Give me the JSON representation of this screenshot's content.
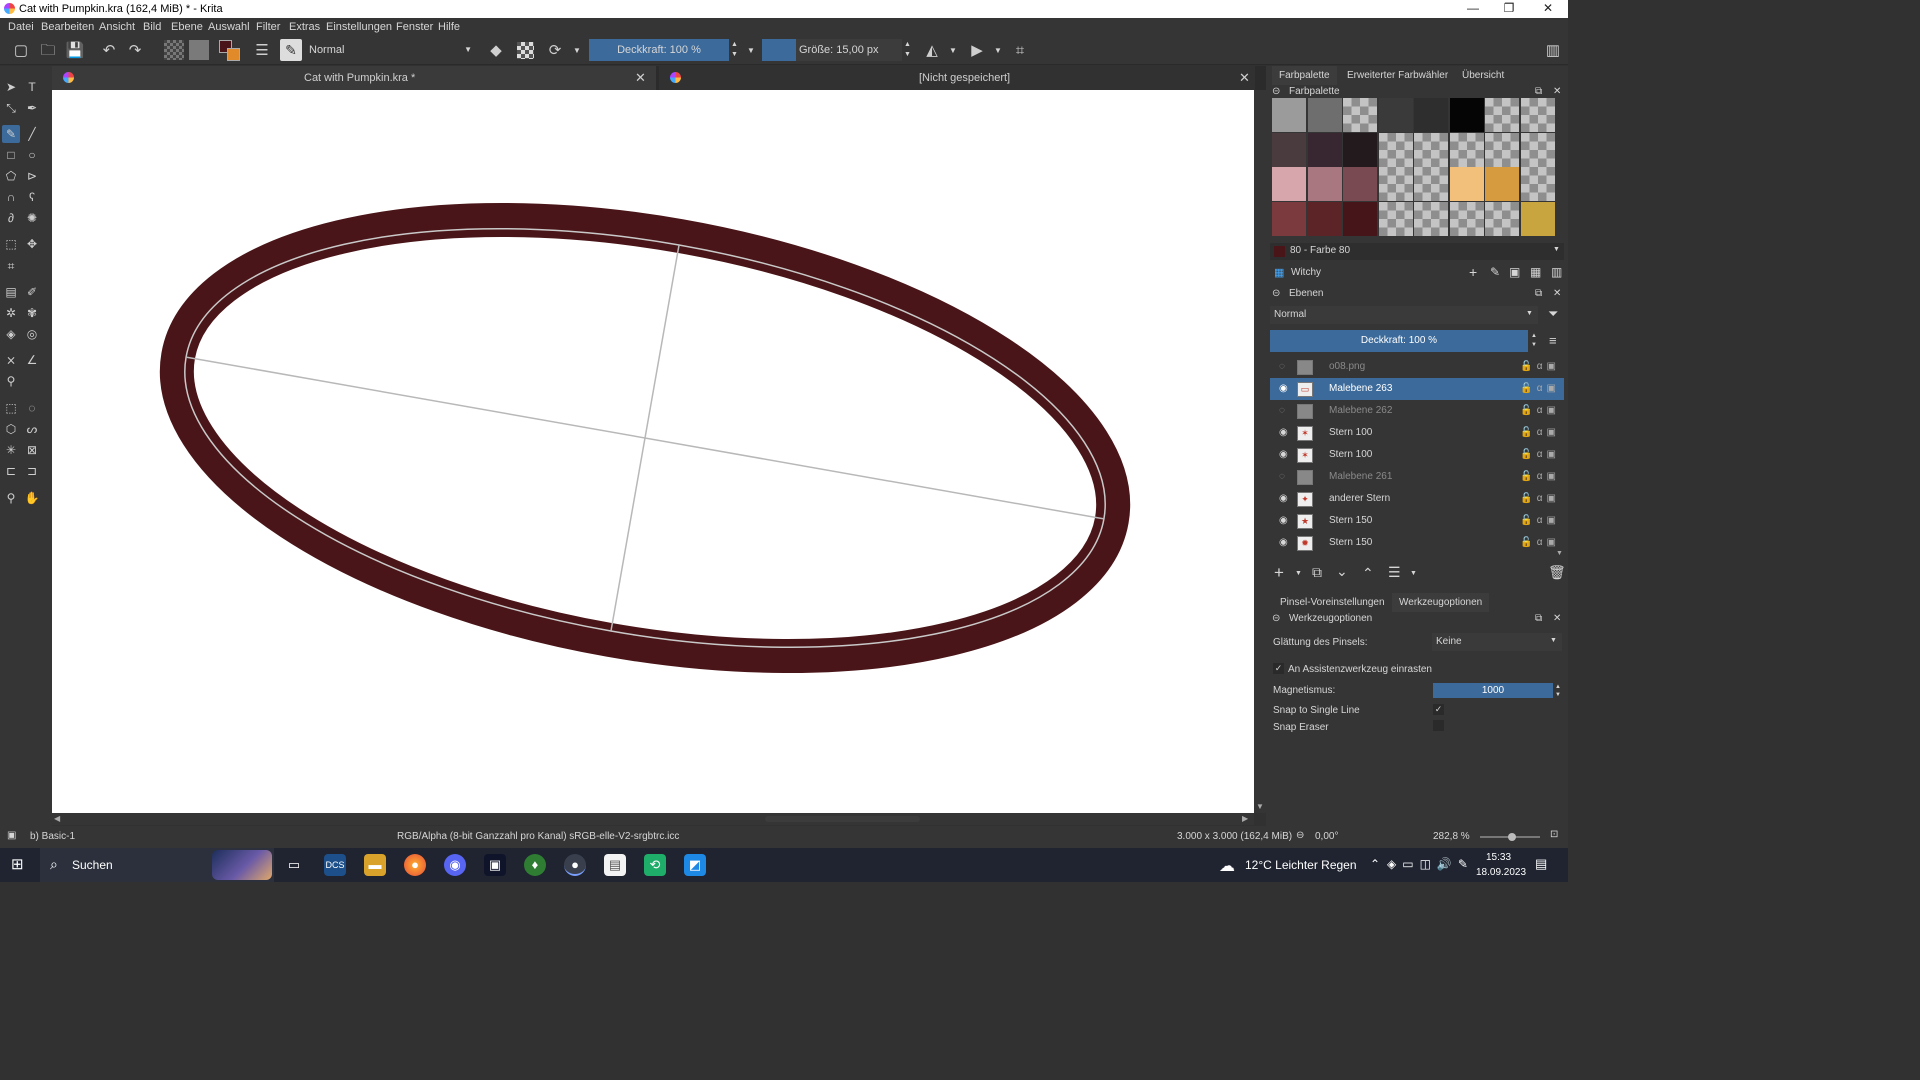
{
  "window": {
    "title": "Cat with Pumpkin.kra (162,4 MiB)  * - Krita",
    "controls": [
      "—",
      "❐",
      "✕"
    ]
  },
  "menu": [
    "Datei",
    "Bearbeiten",
    "Ansicht",
    "Bild",
    "Ebene",
    "Auswahl",
    "Filter",
    "Extras",
    "Einstellungen",
    "Fenster",
    "Hilfe"
  ],
  "toolbar": {
    "blend_mode": "Normal",
    "opacity": "Deckkraft: 100 %",
    "size": "Größe: 15,00 px"
  },
  "tabs": [
    {
      "label": "Cat with Pumpkin.kra *"
    },
    {
      "label": "[Nicht gespeichert]"
    }
  ],
  "docker_tabs": [
    "Farbpalette",
    "Erweiterter Farbwähler",
    "Übersicht"
  ],
  "palette": {
    "title": "Farbpalette",
    "current_color": "80 - Farbe 80",
    "palette_name": "Witchy",
    "colors": [
      [
        "#9b9b9b",
        "#6e6e6e",
        "checker",
        "#3a3a3a",
        "#2e2e2e",
        "#050505",
        "checker",
        "checker"
      ],
      [
        "#4a3b3e",
        "#382630",
        "#231a1d",
        "checker",
        "checker",
        "checker",
        "checker",
        "checker"
      ],
      [
        "#d7a6ad",
        "#a87780",
        "#7a4a52",
        "checker",
        "checker",
        "#f3c07c",
        "#d79b3f",
        "checker"
      ],
      [
        "#7a3a3e",
        "#5d2428",
        "#45151a",
        "checker",
        "checker",
        "checker",
        "checker",
        "#c8a53e"
      ]
    ]
  },
  "layers": {
    "title": "Ebenen",
    "blend_mode": "Normal",
    "opacity": "Deckkraft:  100 %",
    "items": [
      {
        "name": "o08.png",
        "visible": false,
        "selected": false
      },
      {
        "name": "Malebene 263",
        "visible": true,
        "selected": true
      },
      {
        "name": "Malebene 262",
        "visible": false,
        "selected": false
      },
      {
        "name": "Stern 100",
        "visible": true,
        "selected": false
      },
      {
        "name": "Stern 100",
        "visible": true,
        "selected": false
      },
      {
        "name": "Malebene 261",
        "visible": false,
        "selected": false
      },
      {
        "name": "anderer Stern",
        "visible": true,
        "selected": false
      },
      {
        "name": "Stern 150",
        "visible": true,
        "selected": false
      },
      {
        "name": "Stern 150",
        "visible": true,
        "selected": false
      }
    ]
  },
  "tool_options": {
    "tabs": [
      "Pinsel-Voreinstellungen",
      "Werkzeugoptionen"
    ],
    "title": "Werkzeugoptionen",
    "smoothing_label": "Glättung des Pinsels:",
    "smoothing_value": "Keine",
    "snap_assistant_label": "An Assistenzwerkzeug einrasten",
    "snap_assistant_checked": true,
    "magnetism_label": "Magnetismus:",
    "magnetism_value": "1000",
    "snap_single_line_label": "Snap to Single Line",
    "snap_single_line_checked": true,
    "snap_eraser_label": "Snap Eraser",
    "snap_eraser_checked": false
  },
  "status": {
    "brush": "b) Basic-1",
    "color_space": "RGB/Alpha (8-bit Ganzzahl pro Kanal)  sRGB-elle-V2-srgbtrc.icc",
    "image_size": "3.000 x 3.000 (162,4 MiB)",
    "rotation": "0,00°",
    "zoom": "282,8 %"
  },
  "taskbar": {
    "search": "Suchen",
    "weather": "12°C  Leichter Regen",
    "time": "15:33",
    "date": "18.09.2023"
  },
  "colors": {
    "ellipse_stroke": "#4a1518",
    "selection": "#3c6a9a",
    "guide": "#b8b8b8"
  }
}
